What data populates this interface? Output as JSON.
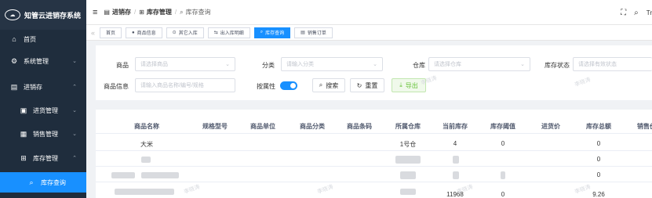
{
  "brand": {
    "title": "知管云进销存系统",
    "logo_icon": "cloud-logo"
  },
  "sidebar": {
    "items": [
      {
        "label": "首页",
        "icon": "home-icon",
        "glyph": "⌂"
      },
      {
        "label": "系统管理",
        "icon": "gear-icon",
        "glyph": "⚙"
      },
      {
        "label": "进销存",
        "icon": "box-icon",
        "glyph": "▤"
      },
      {
        "label": "进货管理",
        "icon": "inbound-icon",
        "glyph": "▣"
      },
      {
        "label": "销售管理",
        "icon": "document-icon",
        "glyph": "▦"
      },
      {
        "label": "库存管理",
        "icon": "warehouse-icon",
        "glyph": "⊞"
      },
      {
        "label": "库存查询",
        "icon": "search-icon",
        "glyph": "⌕"
      }
    ]
  },
  "breadcrumb": {
    "level1": "进销存",
    "level2": "库存管理",
    "level3": "库存查询"
  },
  "topright": {
    "fullscreen_icon": "⛶",
    "search_icon": "⌕",
    "extra": "Tr"
  },
  "tags": [
    {
      "label": "首页",
      "glyph": ""
    },
    {
      "label": "商品信息",
      "glyph": "●"
    },
    {
      "label": "其它入库",
      "glyph": "⊙"
    },
    {
      "label": "出入库明细",
      "glyph": "⇆"
    },
    {
      "label": "库存查询",
      "glyph": "⌕"
    },
    {
      "label": "销售订单",
      "glyph": "▤"
    }
  ],
  "filter": {
    "product_label": "商品",
    "product_placeholder": "请选择商品",
    "category_label": "分类",
    "category_placeholder": "请输入分类",
    "warehouse_label": "仓库",
    "warehouse_placeholder": "请选择仓库",
    "stock_status_label": "库存状态",
    "stock_status_placeholder": "请选择有效状态",
    "info_label": "商品信息",
    "info_placeholder": "请输入商品名称/编号/规格",
    "attr_label": "按属性",
    "search_label": "搜索",
    "reset_label": "重置",
    "export_label": "导出"
  },
  "table": {
    "headers": [
      "商品名称",
      "规格型号",
      "商品单位",
      "商品分类",
      "商品条码",
      "所属仓库",
      "当前库存",
      "库存阈值",
      "进货价",
      "库存总额",
      "销售价"
    ],
    "rows": [
      {
        "name": "大米",
        "warehouse": "1号仓",
        "stock": "4",
        "threshold": "0",
        "total": "0"
      },
      {
        "name": "",
        "warehouse": "",
        "stock": "",
        "threshold": "",
        "total": "0"
      },
      {
        "name": "",
        "warehouse": "",
        "stock": "",
        "threshold": "",
        "total": "0"
      },
      {
        "name": "",
        "warehouse": "",
        "stock": "11968",
        "threshold": "0",
        "total": "9.26"
      }
    ]
  },
  "watermark": "李晓涛",
  "colors": {
    "sidebar_bg": "#1f2d3d",
    "accent": "#1890ff",
    "export_green": "#67c23a"
  }
}
